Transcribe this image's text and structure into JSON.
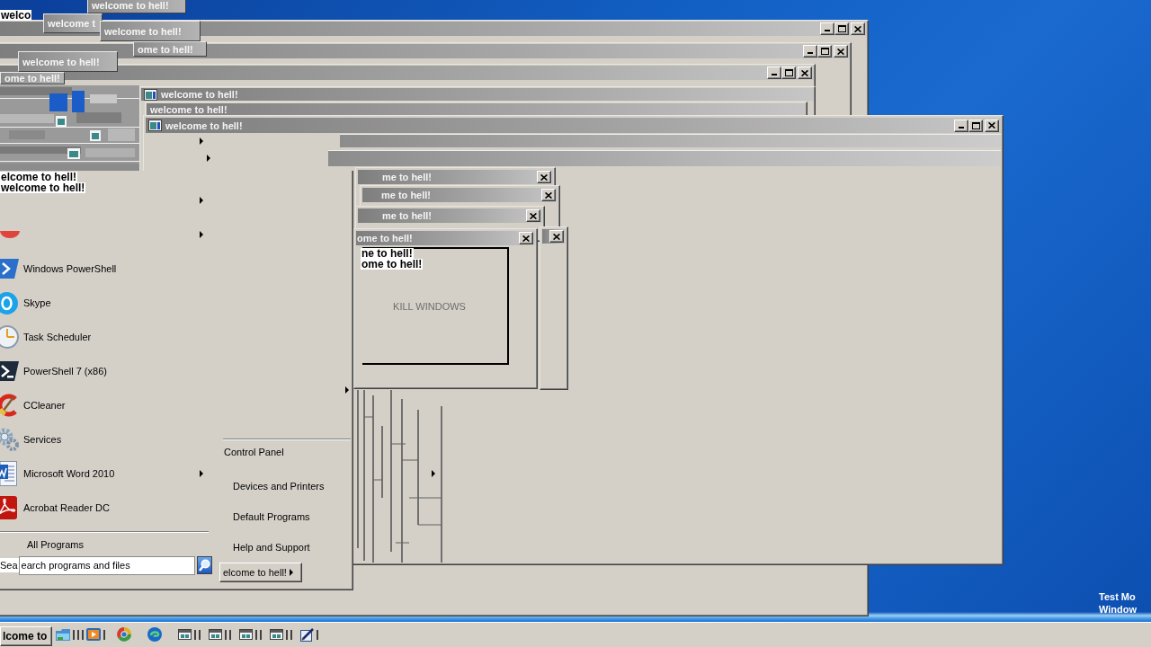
{
  "title_fragments": [
    "welcome to hell!",
    "welcome t",
    "welcome to hell!",
    "welcome to hell!",
    "ome to hell!",
    "ome to hell!"
  ],
  "back_windows": [
    {
      "kind": "window"
    },
    {
      "kind": "window"
    },
    {
      "kind": "window"
    },
    {
      "kind": "strip",
      "title": "welcome to hell!",
      "icon": true
    },
    {
      "kind": "strip",
      "title": "welcome to hell!",
      "icon": false
    }
  ],
  "main_window": {
    "kind": "window",
    "title": "welcome to hell!",
    "icon": true
  },
  "dialogs": [
    {
      "kind": "dialog",
      "title": "me to hell!"
    },
    {
      "kind": "dialog",
      "title": "me to hell!"
    },
    {
      "kind": "dialog",
      "title": "me to hell!"
    },
    {
      "kind": "dialog"
    },
    {
      "kind": "dialog",
      "title": "ome to hell!",
      "message": "KILL WINDOWS"
    }
  ],
  "start_menu": {
    "programs": [
      {
        "name": "Windows PowerShell",
        "kind": "prompt",
        "submenu": false
      },
      {
        "name": "Skype",
        "kind": "disc",
        "submenu": false
      },
      {
        "name": "Task Scheduler",
        "kind": "clock",
        "submenu": false
      },
      {
        "name": "PowerShell 7 (x86)",
        "kind": "console",
        "submenu": false
      },
      {
        "name": "CCleaner",
        "kind": "broom",
        "submenu": false
      },
      {
        "name": "Services",
        "kind": "gear",
        "submenu": false
      },
      {
        "name": "Microsoft Word 2010",
        "kind": "document",
        "submenu": true
      },
      {
        "name": "Acrobat Reader DC",
        "kind": "pdf",
        "submenu": false
      }
    ],
    "all_programs": "All Programs",
    "search": {
      "fragment": "Sea",
      "placeholder": "earch programs and files"
    },
    "places": [
      "Control Panel",
      "Devices and Printers",
      "Default Programs",
      "Help and Support"
    ],
    "shutdown": "elcome to hell!"
  },
  "overlay_labels": [
    "welco",
    "elcome to hell!",
    "welcome to hell!",
    "ne to hell!",
    "ome to hell!"
  ],
  "taskbar": {
    "start_button": "lcome to",
    "items": [
      {
        "kind": "folder"
      },
      {
        "kind": "media"
      },
      {
        "kind": "ring"
      },
      {
        "kind": "swirl"
      },
      {
        "kind": "window"
      },
      {
        "kind": "window"
      },
      {
        "kind": "window"
      },
      {
        "kind": "window"
      },
      {
        "kind": "pen"
      }
    ]
  },
  "test_mode": [
    "Test Mo",
    "Window"
  ]
}
